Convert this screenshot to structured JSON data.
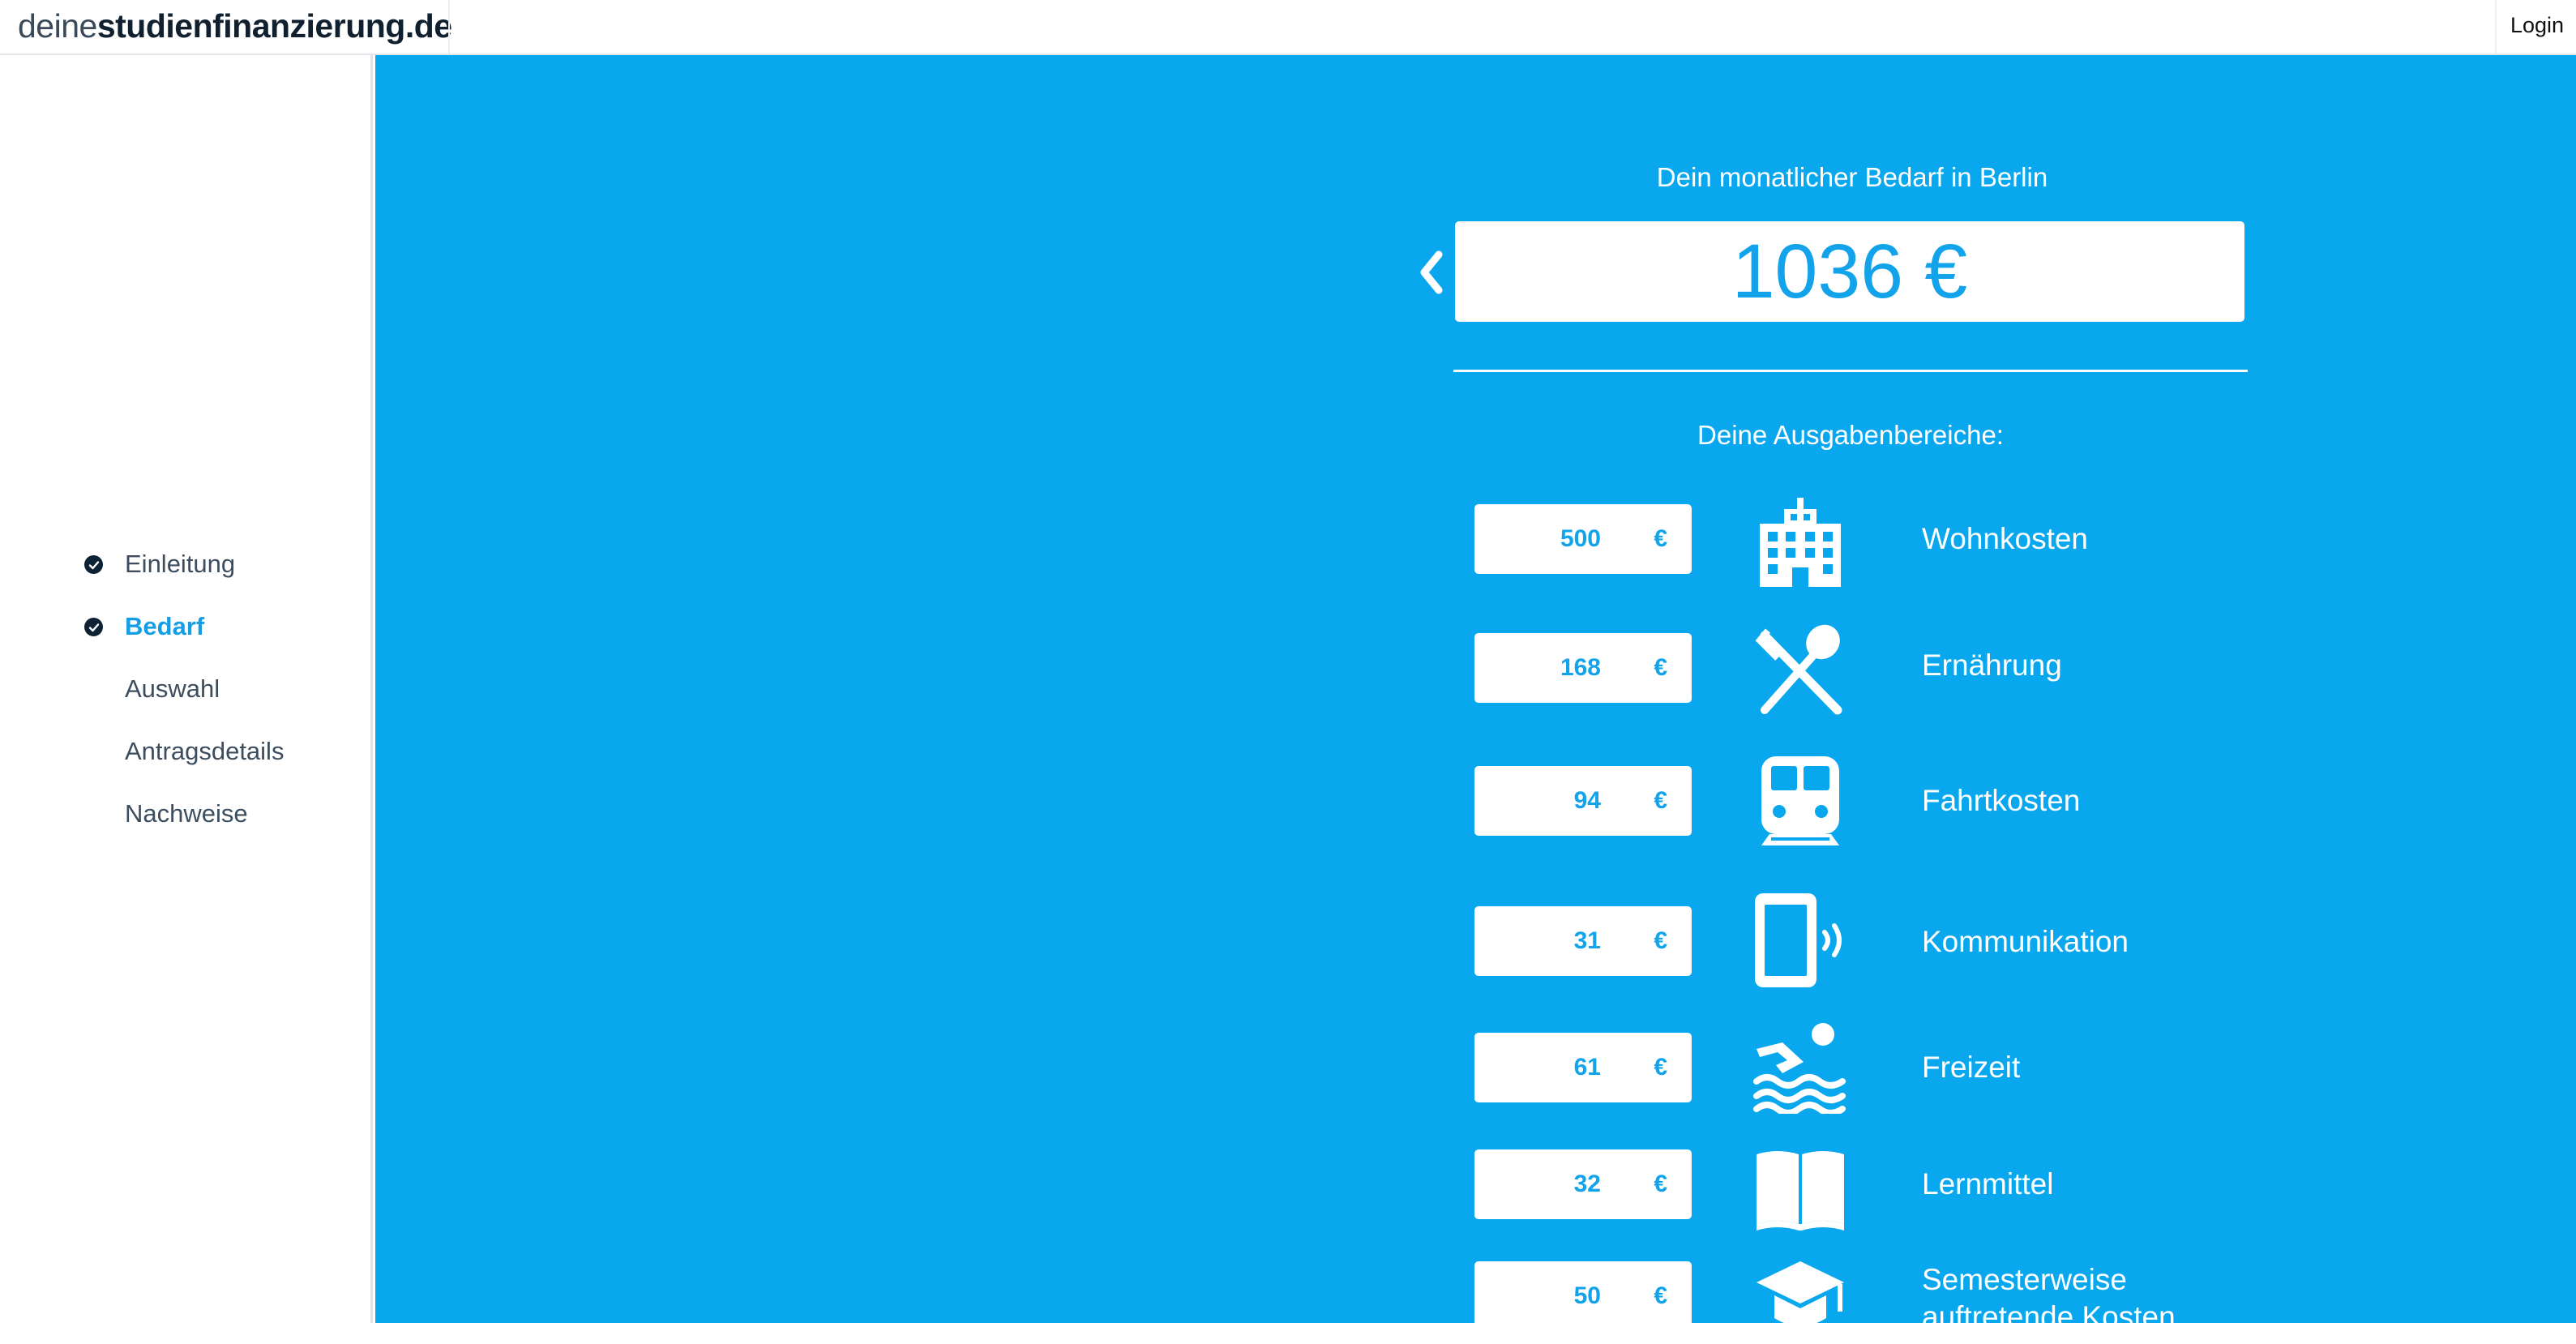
{
  "header": {
    "logo_light": "deine",
    "logo_bold": "studienfinanzierung.de",
    "login_label": "Login"
  },
  "sidebar": {
    "steps": [
      {
        "label": "Einleitung",
        "state": "done"
      },
      {
        "label": "Bedarf",
        "state": "active"
      },
      {
        "label": "Auswahl",
        "state": "open"
      },
      {
        "label": "Antragsdetails",
        "state": "open"
      },
      {
        "label": "Nachweise",
        "state": "open"
      }
    ]
  },
  "main": {
    "need_caption": "Dein monatlicher Bedarf in Berlin",
    "total": "1036 €",
    "areas_caption": "Deine Ausgabenbereiche:",
    "categories": [
      {
        "amount": "500",
        "currency": "€",
        "label": "Wohnkosten",
        "icon": "building-icon"
      },
      {
        "amount": "168",
        "currency": "€",
        "label": "Ernährung",
        "icon": "fork-spoon-icon"
      },
      {
        "amount": "94",
        "currency": "€",
        "label": "Fahrtkosten",
        "icon": "train-icon"
      },
      {
        "amount": "31",
        "currency": "€",
        "label": "Kommunikation",
        "icon": "mobile-phone-icon"
      },
      {
        "amount": "61",
        "currency": "€",
        "label": "Freizeit",
        "icon": "swimmer-icon"
      },
      {
        "amount": "32",
        "currency": "€",
        "label": "Lernmittel",
        "icon": "open-book-icon"
      },
      {
        "amount": "50",
        "currency": "€",
        "label_line1": "Semesterweise",
        "label_line2": "auftretende Kosten",
        "icon": "graduation-cap-icon"
      }
    ]
  },
  "colors": {
    "accent_blue": "#09a8ee",
    "value_blue": "#12a3ea",
    "sidebar_active": "#149ee6",
    "check_dark": "#0e2236"
  }
}
